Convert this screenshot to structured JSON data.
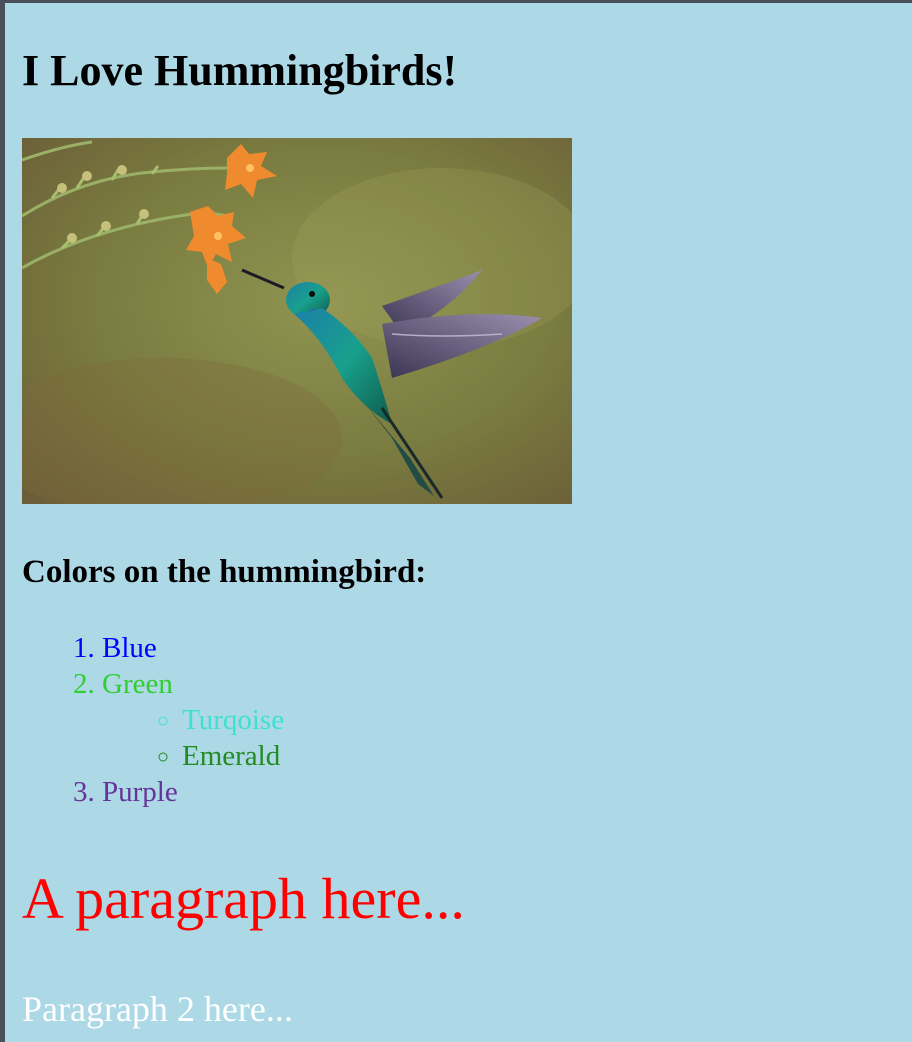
{
  "page": {
    "background": "#add8e6",
    "heading": "I Love Hummingbirds!",
    "image": {
      "semantic": "hummingbird-photo",
      "colors": {
        "background": "#7e8242",
        "bird_body": "#1a9c8c",
        "wing": "#5d4f6e",
        "flower": "#f08a2e"
      }
    },
    "subheading": "Colors on the hummingbird:",
    "colors_list": [
      {
        "marker": "1.",
        "label": "Blue",
        "color": "#0000ff"
      },
      {
        "marker": "2.",
        "label": "Green",
        "color": "#32cd32",
        "sub": [
          {
            "label": "Turqoise",
            "color": "#40e0d0"
          },
          {
            "label": "Emerald",
            "color": "#228b22"
          }
        ]
      },
      {
        "marker": "3.",
        "label": "Purple",
        "color": "#663399"
      }
    ],
    "paragraph_1": {
      "text": "A paragraph here...",
      "color": "#ff0000"
    },
    "paragraph_2": {
      "text": "Paragraph 2 here...",
      "color": "#ffffff"
    }
  }
}
